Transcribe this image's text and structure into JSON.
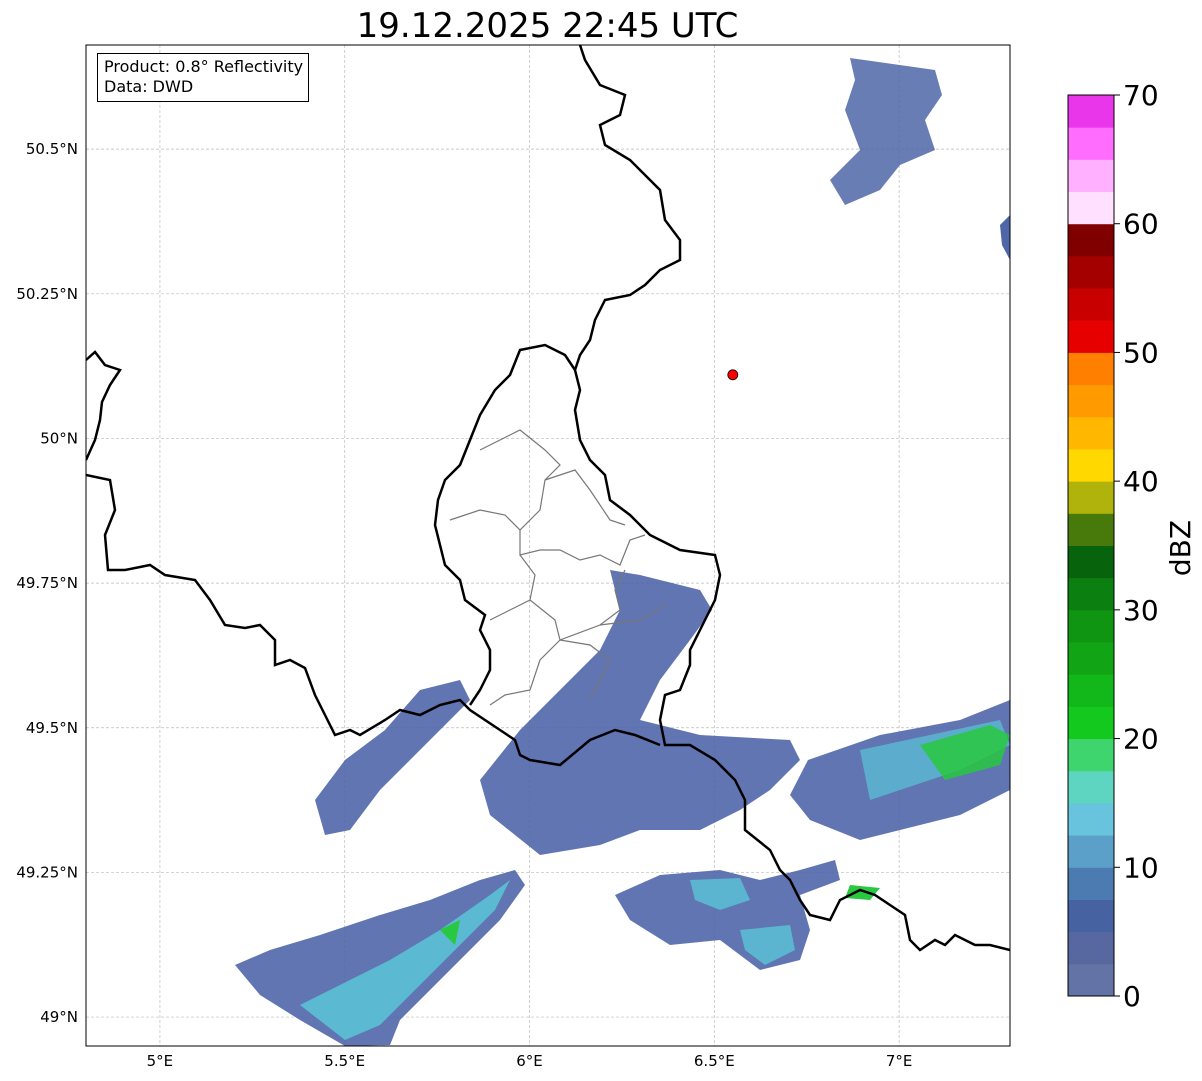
{
  "title": "19.12.2025 22:45 UTC",
  "info_box": {
    "product": "Product: 0.8° Reflectivity",
    "data": "Data: DWD"
  },
  "map_extent": {
    "lon_min": 4.8,
    "lon_max": 7.3,
    "lat_min": 48.95,
    "lat_max": 50.68
  },
  "lat_ticks": [
    {
      "value": 50.5,
      "label": "50.5°N"
    },
    {
      "value": 50.25,
      "label": "50.25°N"
    },
    {
      "value": 50.0,
      "label": "50°N"
    },
    {
      "value": 49.75,
      "label": "49.75°N"
    },
    {
      "value": 49.5,
      "label": "49.5°N"
    },
    {
      "value": 49.25,
      "label": "49.25°N"
    },
    {
      "value": 49.0,
      "label": "49°N"
    }
  ],
  "lon_ticks": [
    {
      "value": 5.0,
      "label": "5°E"
    },
    {
      "value": 5.5,
      "label": "5.5°E"
    },
    {
      "value": 6.0,
      "label": "6°E"
    },
    {
      "value": 6.5,
      "label": "6.5°E"
    },
    {
      "value": 7.0,
      "label": "7°E"
    }
  ],
  "station_marker": {
    "lon": 6.55,
    "lat": 50.11,
    "color": "#ff0000"
  },
  "colorbar": {
    "label": "dBZ",
    "min": 0,
    "max": 70,
    "tick_labels": [
      "0",
      "10",
      "20",
      "30",
      "40",
      "50",
      "60",
      "70"
    ],
    "colors": [
      "#6473a5",
      "#56689f",
      "#4662a0",
      "#4c7bb2",
      "#5ba0c9",
      "#68c3dc",
      "#5dd5c0",
      "#3ed56f",
      "#14c91e",
      "#12b81a",
      "#11a515",
      "#0f9512",
      "#0b7f10",
      "#08640c",
      "#487a0b",
      "#afb30b",
      "#ffd800",
      "#ffb700",
      "#ff9a00",
      "#ff8000",
      "#e60000",
      "#c80000",
      "#a50000",
      "#800000",
      "#ffe1ff",
      "#ffb0ff",
      "#ff6dff",
      "#ea36ea"
    ]
  },
  "echo_colors": {
    "light": "#4f66a8",
    "medium": "#5bc5d8",
    "strong": "#28c840"
  }
}
